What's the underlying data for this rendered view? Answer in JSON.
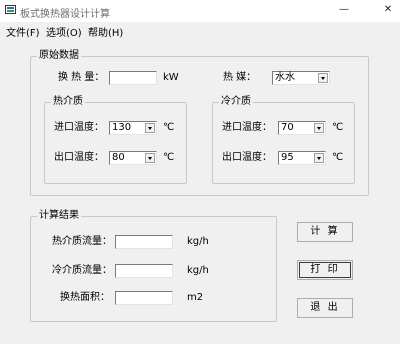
{
  "window": {
    "title": "板式换热器设计计算",
    "minimize": "—",
    "close": "✕"
  },
  "menu": {
    "file": "文件(F)",
    "options": "选项(O)",
    "help": "帮助(H)"
  },
  "original": {
    "legend": "原始数据",
    "heat_exchange_label": "换 热 量：",
    "heat_exchange_value": "",
    "heat_exchange_unit": "kW",
    "medium_label": "热    媒：",
    "medium_value": "水水",
    "hot": {
      "legend": "热介质",
      "inlet_label": "进口温度：",
      "inlet_value": "130",
      "inlet_unit": "℃",
      "outlet_label": "出口温度：",
      "outlet_value": "80",
      "outlet_unit": "℃"
    },
    "cold": {
      "legend": "冷介质",
      "inlet_label": "进口温度：",
      "inlet_value": "70",
      "inlet_unit": "℃",
      "outlet_label": "出口温度：",
      "outlet_value": "95",
      "outlet_unit": "℃"
    }
  },
  "result": {
    "legend": "计算结果",
    "hot_flow_label": "热介质流量：",
    "hot_flow_value": "",
    "hot_flow_unit": "kg/h",
    "cold_flow_label": "冷介质流量：",
    "cold_flow_value": "",
    "cold_flow_unit": "kg/h",
    "area_label": "换热面积：",
    "area_value": "",
    "area_unit": "m2"
  },
  "buttons": {
    "calculate": "计 算",
    "print": "打 印",
    "exit": "退 出"
  }
}
